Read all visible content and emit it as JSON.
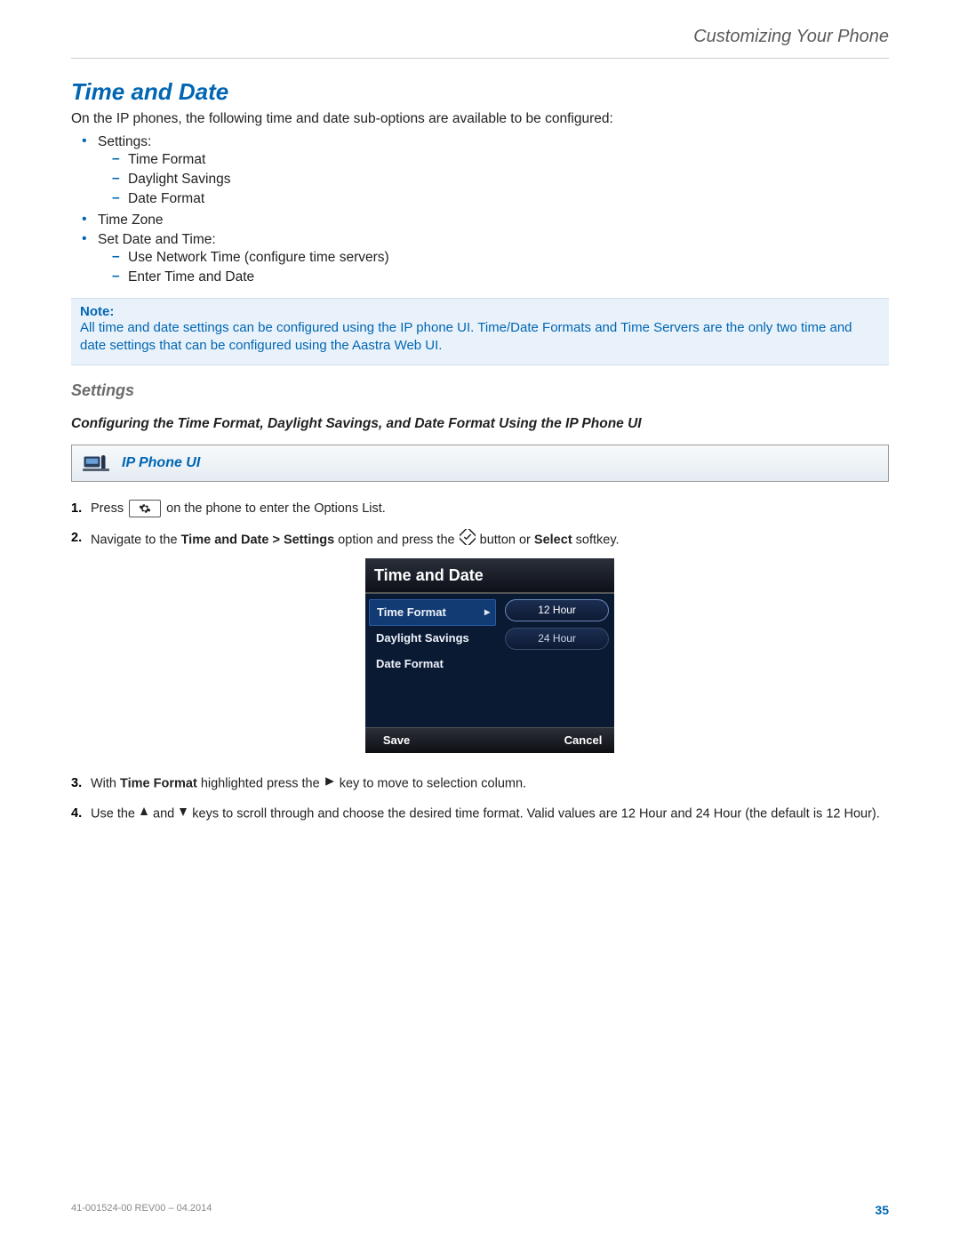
{
  "header": {
    "breadcrumb": "Customizing Your Phone"
  },
  "title": "Time and Date",
  "intro": "On the IP phones, the following time and date sub-options are available to be configured:",
  "bullets": {
    "settings_label": "Settings:",
    "settings_sub": [
      "Time Format",
      "Daylight Savings",
      "Date Format"
    ],
    "timezone": "Time Zone",
    "setdatetime_label": "Set Date and Time:",
    "setdatetime_sub": [
      "Use Network Time (configure time servers)",
      "Enter Time and Date"
    ]
  },
  "note": {
    "label": "Note:",
    "text": "All time and date settings can be configured using the IP phone UI. Time/Date Formats and Time Servers are the only two time and date settings that can be configured using the Aastra Web UI."
  },
  "sub1": "Settings",
  "sub2": "Configuring the Time Format, Daylight Savings, and Date Format Using the IP Phone UI",
  "uibar": "IP Phone UI",
  "steps": {
    "s1a": "Press",
    "s1b": "on the phone to enter the Options List.",
    "s2a": "Navigate to the ",
    "s2b": "Time and Date > Settings",
    "s2c": " option and press the ",
    "s2d": " button or ",
    "s2e": "Select",
    "s2f": " softkey.",
    "s3a": "With ",
    "s3b": "Time Format",
    "s3c": " highlighted press the ",
    "s3d": " key to move to selection column.",
    "s4a": "Use the ",
    "s4b": " and ",
    "s4c": " keys to scroll through and choose the desired time format. Valid values are 12 Hour and 24 Hour (the default is 12 Hour)."
  },
  "phone": {
    "title": "Time and Date",
    "items": [
      "Time Format",
      "Daylight Savings",
      "Date Format"
    ],
    "options": [
      "12 Hour",
      "24 Hour"
    ],
    "save": "Save",
    "cancel": "Cancel"
  },
  "footer": {
    "doc": "41-001524-00 REV00 – 04.2014",
    "page": "35"
  }
}
